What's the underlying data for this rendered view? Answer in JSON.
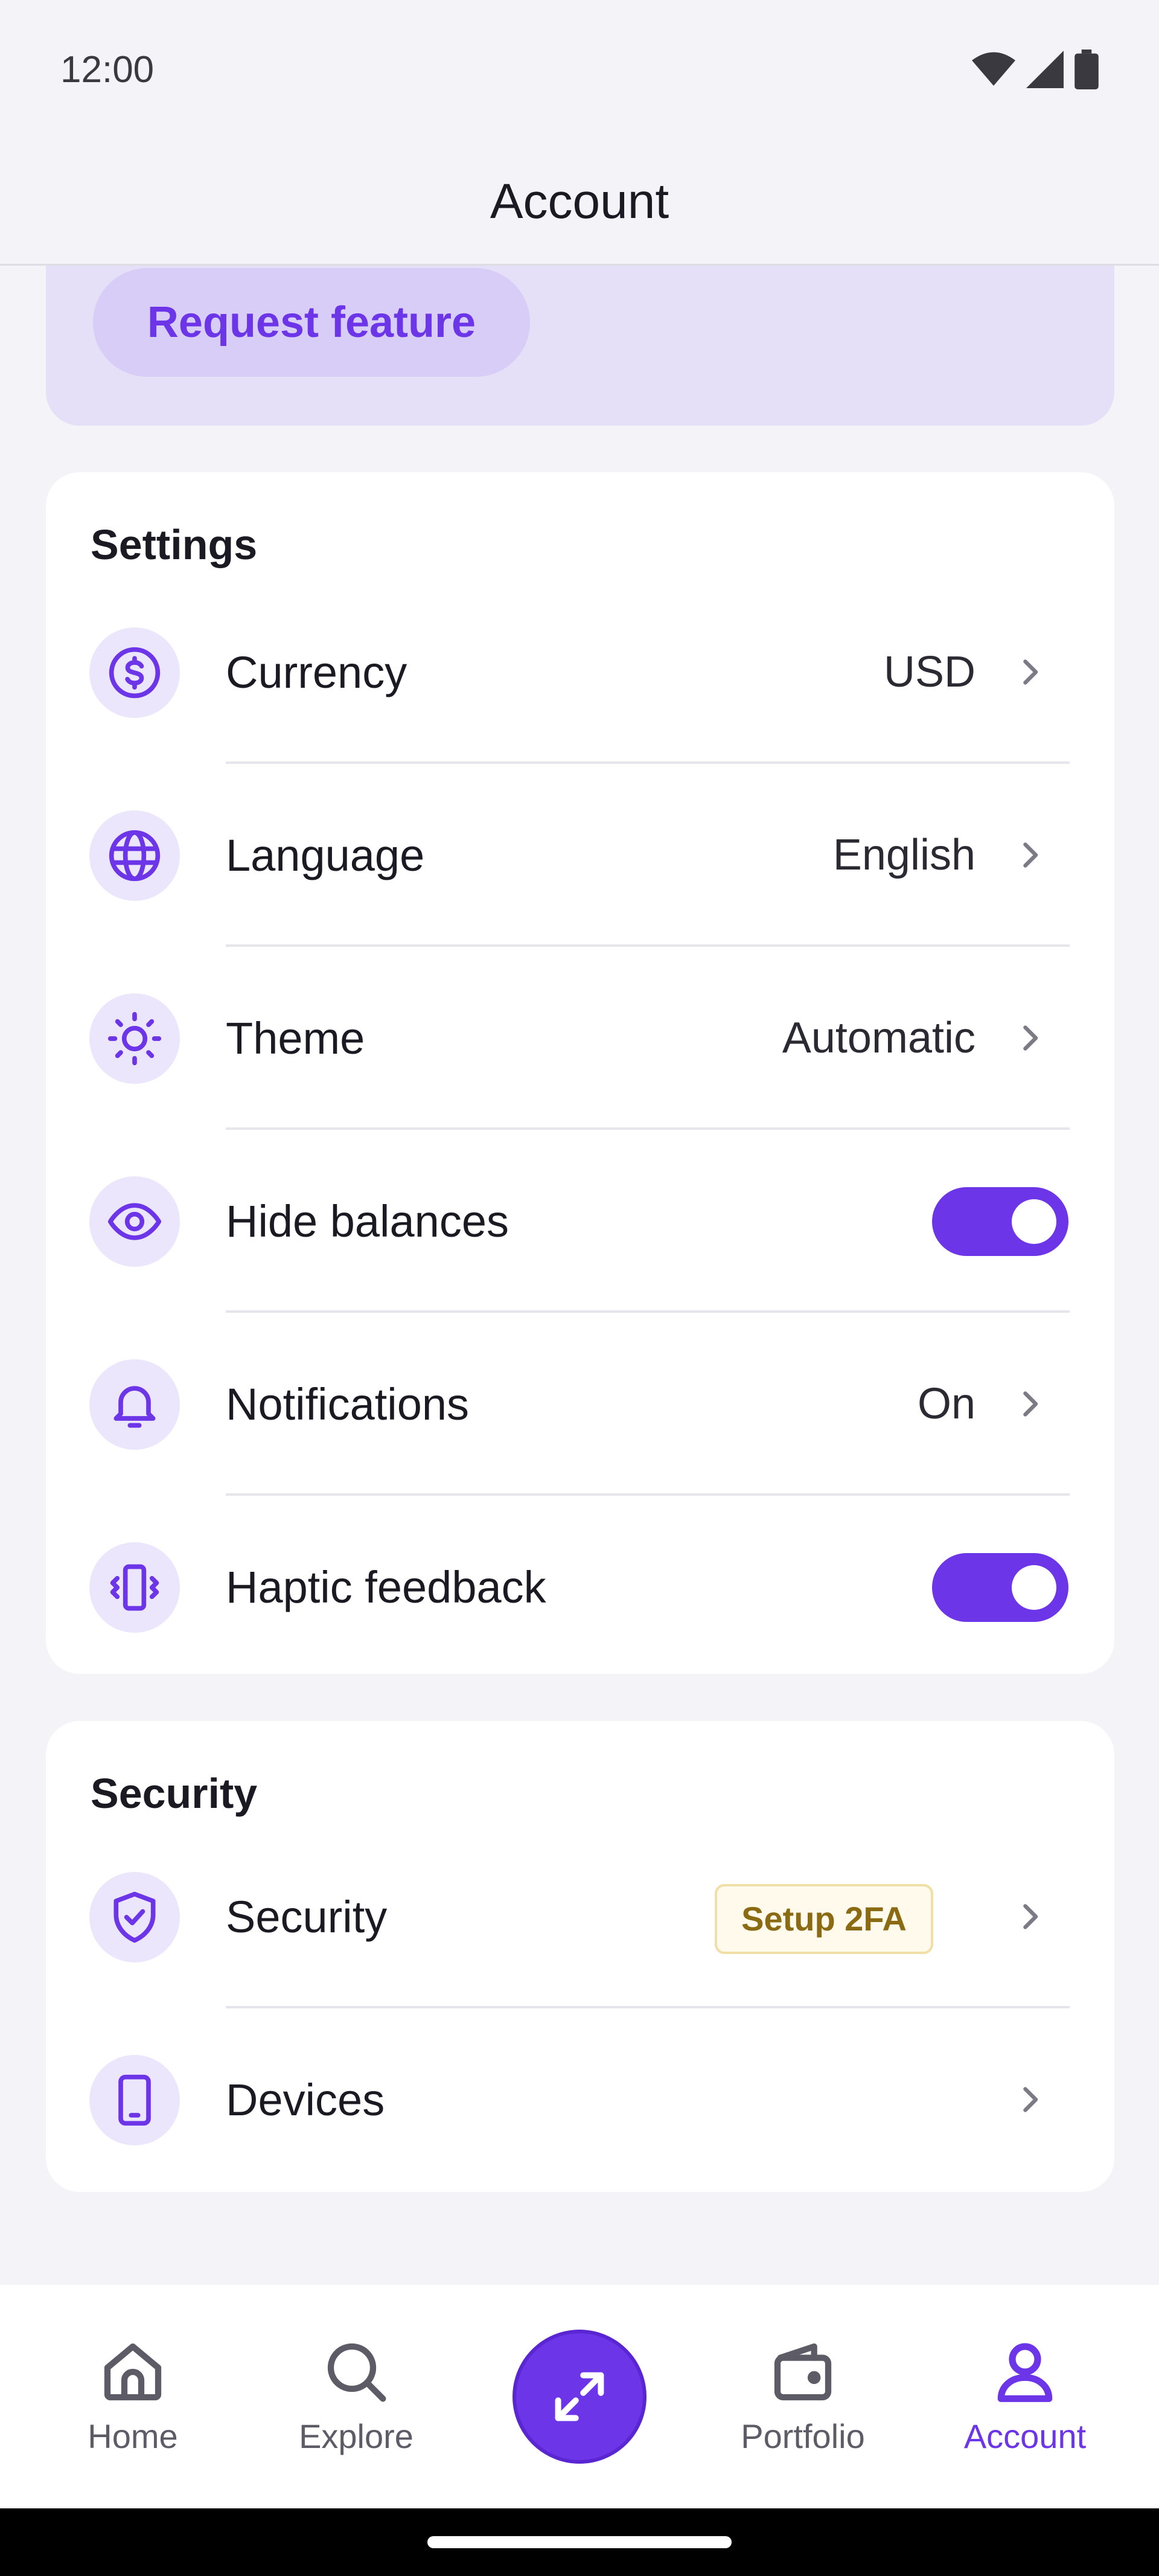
{
  "status_bar": {
    "time": "12:00"
  },
  "header": {
    "title": "Account"
  },
  "feature": {
    "request_label": "Request feature"
  },
  "settings": {
    "title": "Settings",
    "items": [
      {
        "label": "Currency",
        "value": "USD",
        "icon": "currency-dollar-icon"
      },
      {
        "label": "Language",
        "value": "English",
        "icon": "globe-icon"
      },
      {
        "label": "Theme",
        "value": "Automatic",
        "icon": "sun-icon"
      },
      {
        "label": "Hide balances",
        "toggle": true,
        "icon": "eye-icon"
      },
      {
        "label": "Notifications",
        "value": "On",
        "icon": "bell-icon"
      },
      {
        "label": "Haptic feedback",
        "toggle": true,
        "icon": "vibration-icon"
      }
    ]
  },
  "security": {
    "title": "Security",
    "items": [
      {
        "label": "Security",
        "badge": "Setup 2FA",
        "icon": "shield-check-icon"
      },
      {
        "label": "Devices",
        "icon": "phone-icon"
      }
    ]
  },
  "bottom_nav": {
    "items": [
      {
        "label": "Home",
        "icon": "home-icon"
      },
      {
        "label": "Explore",
        "icon": "search-icon"
      },
      {
        "label": "",
        "icon": "swap-arrows-icon"
      },
      {
        "label": "Portfolio",
        "icon": "wallet-icon"
      },
      {
        "label": "Account",
        "icon": "user-icon",
        "active": true
      }
    ]
  },
  "colors": {
    "accent": "#6c35e8",
    "background": "#f4f3f8",
    "card": "#ffffff",
    "icon_bg": "#ece6fc",
    "badge_text": "#8a6a12",
    "badge_bg": "#fffaeb"
  }
}
